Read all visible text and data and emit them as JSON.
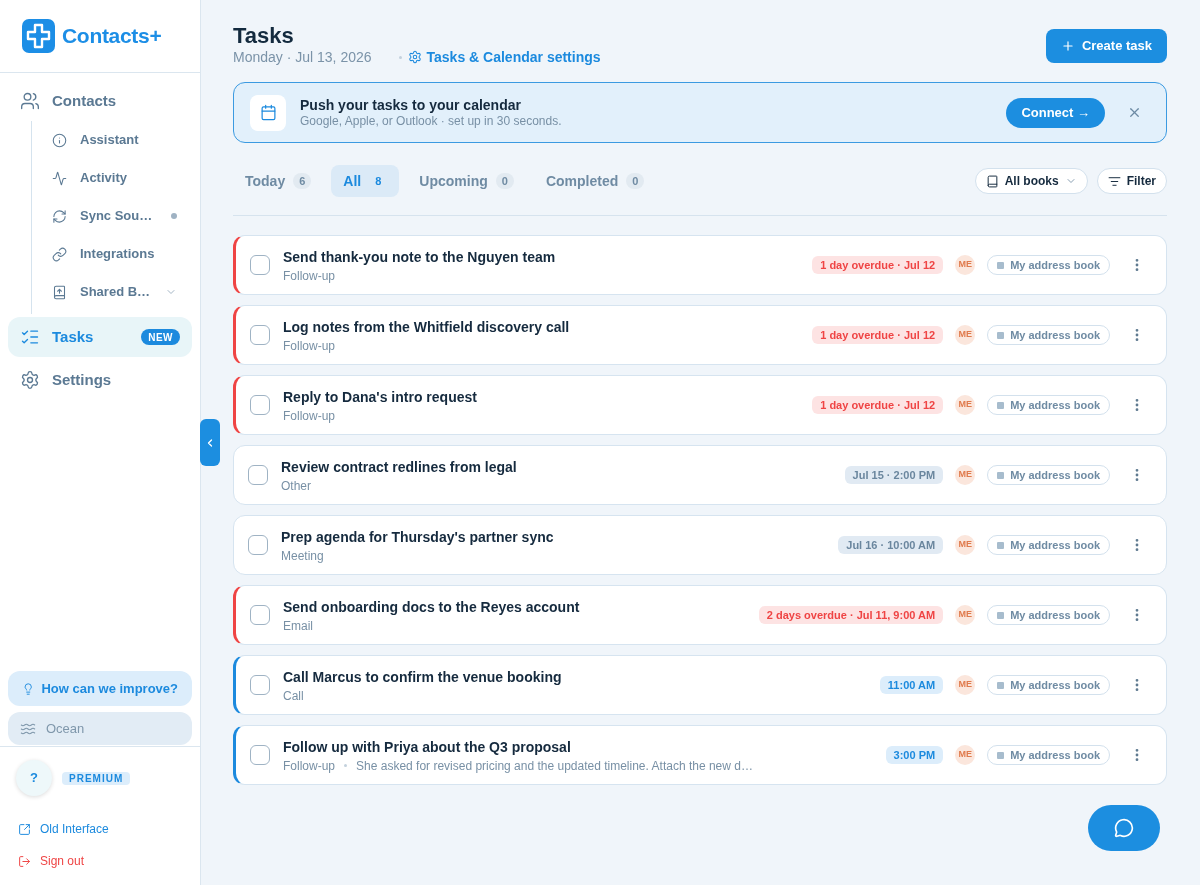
{
  "sidebar": {
    "logo": "Contacts+",
    "nav": [
      {
        "label": "Contacts",
        "selected": false,
        "children": [
          {
            "label": "Assistant",
            "selected": false,
            "dot": false
          },
          {
            "label": "Activity",
            "selected": false,
            "dot": false
          },
          {
            "label": "Sync Sou…",
            "selected": false,
            "dot": true
          },
          {
            "label": "Integrations",
            "selected": false,
            "dot": false
          },
          {
            "label": "Shared B…",
            "selected": false,
            "dot": false,
            "expanded": false
          }
        ]
      },
      {
        "label": "Tasks",
        "selected": true,
        "badge": "NEW"
      },
      {
        "label": "Settings",
        "selected": false
      }
    ],
    "feedback_button": "How can we improve?",
    "theme_button": "Ocean",
    "account": {
      "avatar": "?",
      "plan": "PREMIUM"
    },
    "links": [
      {
        "label": "Old Interface",
        "kind": "external"
      },
      {
        "label": "Sign out",
        "kind": "signout"
      }
    ]
  },
  "header": {
    "title": "Tasks",
    "date": "Monday · Jul 13, 2026",
    "settings_link": "Tasks & Calendar settings",
    "create_button": "Create task"
  },
  "banner": {
    "title": "Push your tasks to your calendar",
    "subtitle": "Google, Apple, or Outlook · set up in 30 seconds.",
    "connect_button": "Connect →"
  },
  "tabs": [
    {
      "label": "Today",
      "count": "6",
      "selected": false
    },
    {
      "label": "All",
      "count": "8",
      "selected": true
    },
    {
      "label": "Upcoming",
      "count": "0",
      "selected": false
    },
    {
      "label": "Completed",
      "count": "0",
      "selected": false
    }
  ],
  "filters": [
    {
      "label": "All books",
      "kind": "dropdown"
    },
    {
      "label": "Filter",
      "kind": "filter"
    }
  ],
  "tasks": [
    {
      "title": "Send thank-you note to the Nguyen team",
      "category": "Follow-up",
      "checked": false,
      "due": {
        "text": "1 day overdue · Jul 12",
        "kind": "overdue"
      },
      "assignee": "ME",
      "book": "My address book"
    },
    {
      "title": "Log notes from the Whitfield discovery call",
      "category": "Follow-up",
      "checked": false,
      "due": {
        "text": "1 day overdue · Jul 12",
        "kind": "overdue"
      },
      "assignee": "ME",
      "book": "My address book"
    },
    {
      "title": "Reply to Dana's intro request",
      "category": "Follow-up",
      "checked": false,
      "due": {
        "text": "1 day overdue · Jul 12",
        "kind": "overdue"
      },
      "assignee": "ME",
      "book": "My address book"
    },
    {
      "title": "Review contract redlines from legal",
      "category": "Other",
      "checked": false,
      "due": {
        "text": "Jul 15 · 2:00 PM",
        "kind": "future"
      },
      "assignee": "ME",
      "book": "My address book"
    },
    {
      "title": "Prep agenda for Thursday's partner sync",
      "category": "Meeting",
      "checked": false,
      "due": {
        "text": "Jul 16 · 10:00 AM",
        "kind": "future"
      },
      "assignee": "ME",
      "book": "My address book"
    },
    {
      "title": "Send onboarding docs to the Reyes account",
      "category": "Email",
      "checked": false,
      "due": {
        "text": "2 days overdue · Jul 11, 9:00 AM",
        "kind": "overdue"
      },
      "assignee": "ME",
      "book": "My address book"
    },
    {
      "title": "Call Marcus to confirm the venue booking",
      "category": "Call",
      "checked": false,
      "due": {
        "text": "11:00 AM",
        "kind": "today"
      },
      "assignee": "ME",
      "book": "My address book"
    },
    {
      "title": "Follow up with Priya about the Q3 proposal",
      "category": "Follow-up",
      "note": "She asked for revised pricing and the updated timeline. Attach the new d…",
      "checked": false,
      "due": {
        "text": "3:00 PM",
        "kind": "today"
      },
      "assignee": "ME",
      "book": "My address book"
    }
  ]
}
